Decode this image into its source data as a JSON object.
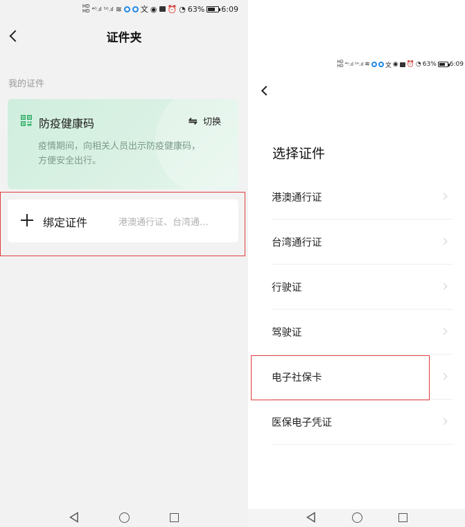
{
  "left": {
    "status_bar": {
      "battery": "63%",
      "time": "6:09"
    },
    "header": {
      "title": "证件夹"
    },
    "section_label": "我的证件",
    "health_card": {
      "title": "防疫健康码",
      "switch_label": "切换",
      "description": "疫情期间，向相关人员出示防疫健康码，方便安全出行。",
      "icon": "qr-code-icon",
      "color": "#d6f0e2"
    },
    "bind_card": {
      "label": "绑定证件",
      "hint": "港澳通行证、台湾通…"
    },
    "highlight_color": "#e23c3c"
  },
  "right": {
    "status_bar": {
      "battery": "63%",
      "time": "6:09"
    },
    "title": "选择证件",
    "documents": [
      {
        "label": "港澳通行证"
      },
      {
        "label": "台湾通行证"
      },
      {
        "label": "行驶证"
      },
      {
        "label": "驾驶证"
      },
      {
        "label": "电子社保卡"
      },
      {
        "label": "医保电子凭证"
      }
    ]
  }
}
